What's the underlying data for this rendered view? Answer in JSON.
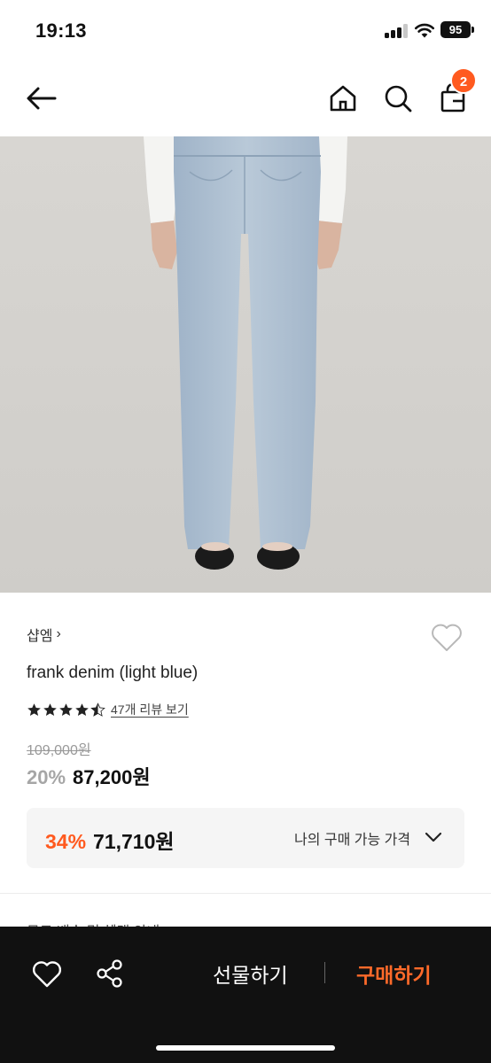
{
  "status_bar": {
    "time": "19:13",
    "battery": "95",
    "icons": [
      "signal-icon",
      "wifi-icon",
      "battery-icon"
    ]
  },
  "nav": {
    "icons": [
      "back-arrow-icon",
      "home-icon",
      "search-icon",
      "shopping-bag-icon"
    ],
    "cart_count": "2"
  },
  "product": {
    "brand": "샵엠",
    "brand_chevron": "›",
    "name": "frank denim (light blue)",
    "rating": 4.5,
    "review_link": "47개 리뷰 보기",
    "original_price": "109,000원",
    "discount_rate": "20%",
    "discount_price": "87,200원"
  },
  "my_price": {
    "rate": "34%",
    "price": "71,710원",
    "label": "나의 구매 가능 가격"
  },
  "peek_text": "무료 배송 및 혜택 안내",
  "bottom_bar": {
    "gift_label": "선물하기",
    "buy_label": "구매하기",
    "icons": [
      "heart-icon",
      "share-icon"
    ]
  },
  "colors": {
    "accent": "#ff5a1f",
    "buy_text": "#ff6a2a",
    "bottom_bar_bg": "#111111",
    "price_box_bg": "#f5f5f5"
  }
}
